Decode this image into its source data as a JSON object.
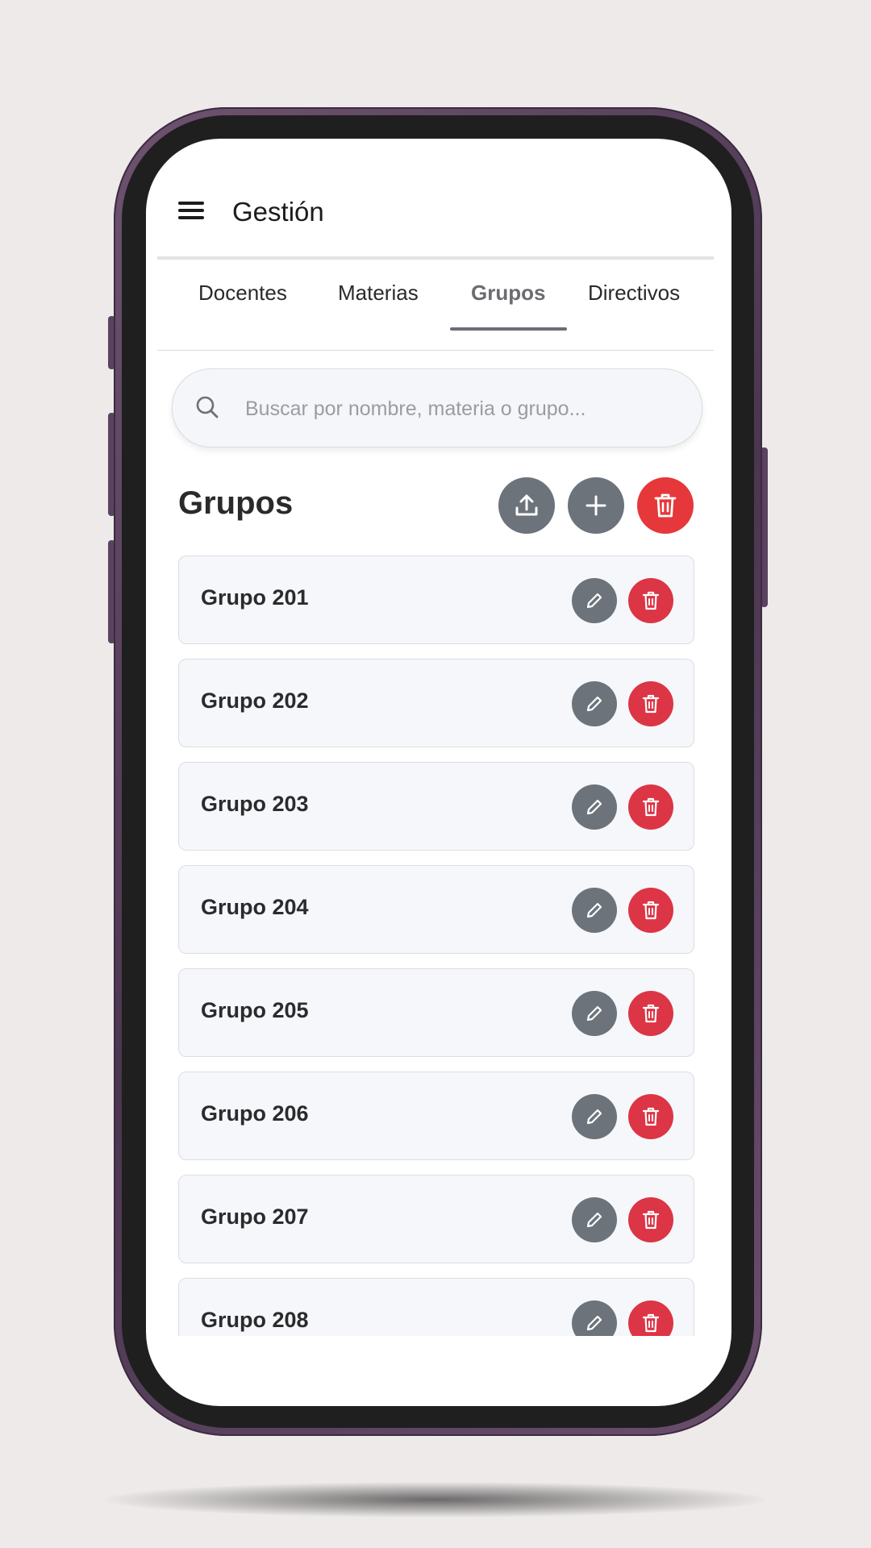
{
  "app": {
    "title": "Gestión"
  },
  "tabs": [
    {
      "label": "Docentes",
      "active": false
    },
    {
      "label": "Materias",
      "active": false
    },
    {
      "label": "Grupos",
      "active": true
    },
    {
      "label": "Directivos",
      "active": false
    }
  ],
  "search": {
    "placeholder": "Buscar por nombre, materia o grupo...",
    "value": ""
  },
  "section": {
    "title": "Grupos",
    "actions": [
      {
        "icon": "upload-icon"
      },
      {
        "icon": "plus-icon"
      },
      {
        "icon": "trash-icon"
      }
    ]
  },
  "groups": [
    {
      "name": "Grupo 201"
    },
    {
      "name": "Grupo 202"
    },
    {
      "name": "Grupo 203"
    },
    {
      "name": "Grupo 204"
    },
    {
      "name": "Grupo 205"
    },
    {
      "name": "Grupo 206"
    },
    {
      "name": "Grupo 207"
    },
    {
      "name": "Grupo 208"
    }
  ],
  "colors": {
    "accent_gray": "#6c737b",
    "danger_red": "#e6383a",
    "frame": "#5a4260"
  }
}
